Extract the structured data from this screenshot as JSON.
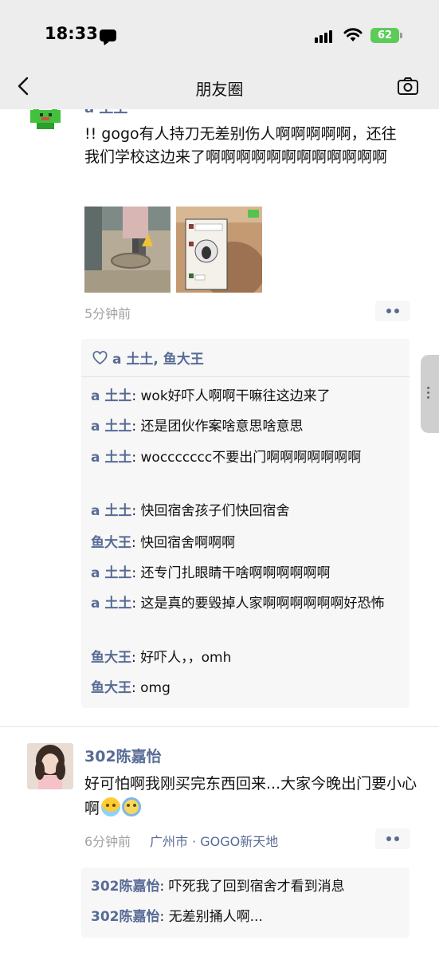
{
  "status_bar": {
    "time": "18:33",
    "battery": "62"
  },
  "nav": {
    "title": "朋友圈"
  },
  "posts": [
    {
      "author": "a 土土",
      "text": "!! gogo有人持刀无差别伤人啊啊啊啊啊，还往我们学校这边来了啊啊啊啊啊啊啊啊啊啊啊啊",
      "photos": [
        {
          "kind": "mall-floor-photo"
        },
        {
          "kind": "screenshot-photo"
        }
      ],
      "time": "5分钟前",
      "likes": "a 土土, 鱼大王",
      "comments": [
        {
          "who": "a 土土",
          "text": ": wok好吓人啊啊干嘛往这边来了"
        },
        {
          "who": "a 土土",
          "text": ": 还是团伙作案啥意思啥意思"
        },
        {
          "who": "a 土土",
          "text": ": woccccccc不要出门啊啊啊啊啊啊啊"
        },
        {
          "who": "a 土土",
          "text": ": 快回宿舍孩子们快回宿舍"
        },
        {
          "who": "鱼大王",
          "text": ": 快回宿舍啊啊啊"
        },
        {
          "who": "a 土土",
          "text": ": 还专门扎眼睛干啥啊啊啊啊啊啊"
        },
        {
          "who": "a 土土",
          "text": ": 这是真的要毁掉人家啊啊啊啊啊啊好恐怖"
        },
        {
          "who": "鱼大王",
          "text": ": 好吓人，，omh"
        },
        {
          "who": "鱼大王",
          "text": ": omg"
        }
      ]
    },
    {
      "author": "302陈嘉怡",
      "text": "好可怕啊我刚买完东西回来...大家今晚出门要小心啊",
      "time": "6分钟前",
      "location": "广州市 · GOGO新天地",
      "comments": [
        {
          "who": "302陈嘉怡",
          "text": ": 吓死我了回到宿舍才看到消息"
        },
        {
          "who": "302陈嘉怡",
          "text": ": 无差别捅人啊..."
        }
      ]
    }
  ],
  "colors": {
    "link": "#576b95",
    "meta": "#a3a3a3",
    "nav_bg": "#ededed",
    "comment_bg": "#f7f7f7"
  }
}
